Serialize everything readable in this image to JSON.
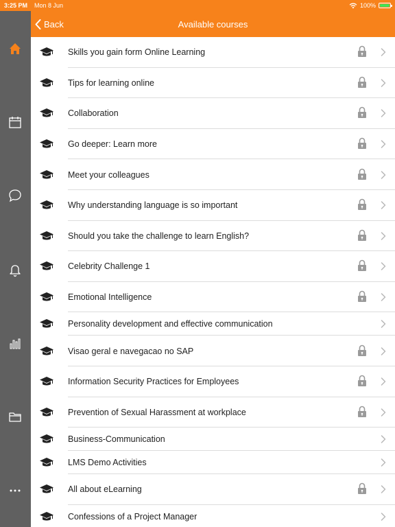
{
  "status": {
    "time": "3:25 PM",
    "date": "Mon 8 Jun",
    "battery": "100%",
    "battery_level": 1.0
  },
  "nav": {
    "back_label": "Back",
    "title": "Available courses"
  },
  "colors": {
    "accent": "#f7821b",
    "sidebar": "#606060",
    "icon": "#222222",
    "lock": "#9a9a9a",
    "chevron": "#b8b8b8"
  },
  "sidebar": {
    "items": [
      {
        "icon": "home-icon",
        "active": true
      },
      {
        "icon": "calendar-icon"
      },
      {
        "icon": "chat-icon"
      },
      {
        "icon": "bell-icon"
      },
      {
        "icon": "bar-chart-icon"
      },
      {
        "icon": "folder-icon"
      },
      {
        "icon": "more-icon"
      }
    ]
  },
  "courses": [
    {
      "title": "Skills you gain form Online Learning",
      "locked": true
    },
    {
      "title": "Tips for learning online",
      "locked": true
    },
    {
      "title": "Collaboration",
      "locked": true
    },
    {
      "title": "Go deeper: Learn more",
      "locked": true
    },
    {
      "title": "Meet your colleagues",
      "locked": true
    },
    {
      "title": "Why understanding language is so important",
      "locked": true
    },
    {
      "title": "Should you take the challenge to learn English?",
      "locked": true
    },
    {
      "title": "Celebrity Challenge 1",
      "locked": true
    },
    {
      "title": "Emotional Intelligence",
      "locked": true
    },
    {
      "title": "Personality development and effective communication",
      "locked": false
    },
    {
      "title": "Visao geral e navegacao no SAP",
      "locked": true
    },
    {
      "title": "Information Security Practices for Employees",
      "locked": true
    },
    {
      "title": "Prevention of Sexual Harassment at workplace",
      "locked": true
    },
    {
      "title": "Business-Communication",
      "locked": false
    },
    {
      "title": "LMS Demo Activities",
      "locked": false
    },
    {
      "title": "All about eLearning",
      "locked": true
    },
    {
      "title": "Confessions of a Project Manager",
      "locked": false
    }
  ]
}
